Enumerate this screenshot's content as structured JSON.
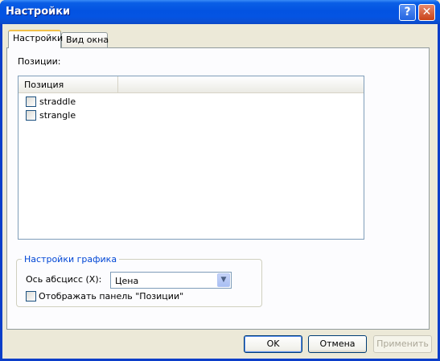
{
  "window": {
    "title": "Настройки",
    "help_glyph": "?",
    "close_glyph": "✕"
  },
  "tabs": [
    {
      "label": "Настройки",
      "active": true
    },
    {
      "label": "Вид окна",
      "active": false
    }
  ],
  "positions": {
    "section_label": "Позиции:",
    "column_header": "Позиция",
    "items": [
      {
        "label": "straddle",
        "checked": false
      },
      {
        "label": "strangle",
        "checked": false
      }
    ]
  },
  "chart_settings": {
    "group_title": "Настройки графика",
    "x_axis_label": "Ось абсцисс (X):",
    "x_axis_value": "Цена",
    "show_panel_label": "Отображать панель \"Позиции\"",
    "show_panel_checked": false
  },
  "buttons": {
    "ok": "OK",
    "cancel": "Отмена",
    "apply": "Применить"
  },
  "colors": {
    "titlebar": "#0353e1",
    "group_title": "#0046d5",
    "disabled_text": "#aca899"
  }
}
